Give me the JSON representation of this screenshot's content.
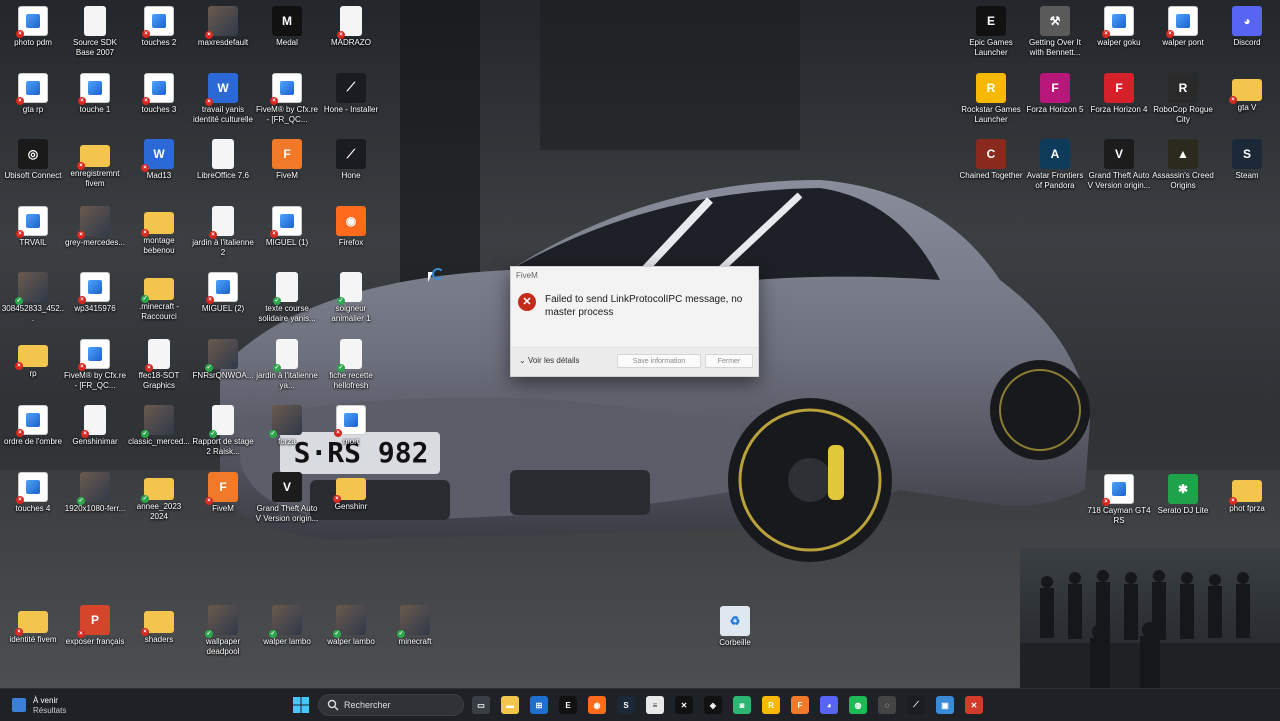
{
  "desktop": {
    "left_icons": [
      {
        "label": "photo pdm",
        "type": "img",
        "badge": "err"
      },
      {
        "label": "Source SDK Base 2007",
        "type": "doc",
        "badge": ""
      },
      {
        "label": "touches 2",
        "type": "img",
        "badge": "err"
      },
      {
        "label": "maxresdefault",
        "type": "photo",
        "badge": "err"
      },
      {
        "label": "Medal",
        "type": "app-medal",
        "badge": ""
      },
      {
        "label": "MADRAZO",
        "type": "doc",
        "badge": "err"
      },
      {
        "label": "gta rp",
        "type": "img",
        "badge": "err"
      },
      {
        "label": "touche 1",
        "type": "img",
        "badge": "err"
      },
      {
        "label": "touches 3",
        "type": "img",
        "badge": "err"
      },
      {
        "label": "travail yanis identité culturelle",
        "type": "doc-blue",
        "badge": "err"
      },
      {
        "label": "FiveM® by Cfx.re - [FR_QC...",
        "type": "img",
        "badge": "err"
      },
      {
        "label": "Hone - Installer",
        "type": "app-hone",
        "badge": ""
      },
      {
        "label": "Ubisoft Connect",
        "type": "app-ubisoft",
        "badge": ""
      },
      {
        "label": "enregistremnt fivem",
        "type": "folder",
        "badge": "err"
      },
      {
        "label": "Mad13",
        "type": "doc-blue",
        "badge": "err"
      },
      {
        "label": "LibreOffice 7.6",
        "type": "doc",
        "badge": ""
      },
      {
        "label": "FiveM",
        "type": "app-fivem",
        "badge": ""
      },
      {
        "label": "Hone",
        "type": "app-hone",
        "badge": ""
      },
      {
        "label": "TRVAIL",
        "type": "img",
        "badge": "err"
      },
      {
        "label": "grey-mercedes...",
        "type": "photo",
        "badge": "err"
      },
      {
        "label": "montage bebenou",
        "type": "folder",
        "badge": "err"
      },
      {
        "label": "jardin à l'italienne 2",
        "type": "doc",
        "badge": "err"
      },
      {
        "label": "MIGUEL (1)",
        "type": "img",
        "badge": "err"
      },
      {
        "label": "Firefox",
        "type": "app-firefox",
        "badge": ""
      },
      {
        "label": "308452833_452...",
        "type": "photo",
        "badge": "ok"
      },
      {
        "label": "wp3415976",
        "type": "img",
        "badge": "err"
      },
      {
        "label": ".minecraft - Raccourci",
        "type": "folder",
        "badge": "ok"
      },
      {
        "label": "MIGUEL (2)",
        "type": "img",
        "badge": "err"
      },
      {
        "label": "texte course solidaire yanis...",
        "type": "doc",
        "badge": "ok"
      },
      {
        "label": "soigneur animalier 1",
        "type": "doc",
        "badge": "ok"
      },
      {
        "label": "rp",
        "type": "folder",
        "badge": "err"
      },
      {
        "label": "FiveM® by Cfx.re - [FR_QC...",
        "type": "img",
        "badge": "err"
      },
      {
        "label": "ffec18-SOT Graphics",
        "type": "doc",
        "badge": "err"
      },
      {
        "label": "FNRsrQNWOA...",
        "type": "photo",
        "badge": "ok"
      },
      {
        "label": "jardin à l'italienne ya...",
        "type": "doc",
        "badge": "ok"
      },
      {
        "label": "fiche recette hellofresh",
        "type": "doc",
        "badge": "ok"
      },
      {
        "label": "ordre de l'ombre",
        "type": "img",
        "badge": "err"
      },
      {
        "label": "Genshinimar",
        "type": "doc",
        "badge": "err"
      },
      {
        "label": "classic_merced...",
        "type": "photo",
        "badge": "ok"
      },
      {
        "label": "Rapport de stage 2 Raisk...",
        "type": "doc",
        "badge": "ok"
      },
      {
        "label": "forza",
        "type": "photo",
        "badge": "ok"
      },
      {
        "label": "mort",
        "type": "img",
        "badge": "err"
      },
      {
        "label": "touches 4",
        "type": "img",
        "badge": "err"
      },
      {
        "label": "1920x1080-ferr...",
        "type": "photo",
        "badge": "ok"
      },
      {
        "label": "annee_2023 2024",
        "type": "folder",
        "badge": "ok"
      },
      {
        "label": "FiveM",
        "type": "app-fivem",
        "badge": "err"
      },
      {
        "label": "Grand Theft Auto V Version origin...",
        "type": "app-gta",
        "badge": ""
      },
      {
        "label": "Genshinr",
        "type": "folder",
        "badge": "err"
      },
      {
        "label": "identité fivem",
        "type": "folder",
        "badge": "err"
      },
      {
        "label": "exposer français",
        "type": "doc-red",
        "badge": "err"
      },
      {
        "label": "shaders",
        "type": "folder",
        "badge": "err"
      },
      {
        "label": "wallpaper deadpool",
        "type": "photo",
        "badge": "ok"
      },
      {
        "label": "walper lambo",
        "type": "photo",
        "badge": "ok"
      },
      {
        "label": "walper lambo",
        "type": "photo",
        "badge": "ok"
      },
      {
        "label": "minecraft",
        "type": "photo",
        "badge": "ok"
      }
    ],
    "right_icons": [
      {
        "label": "Epic Games Launcher",
        "type": "app-epic",
        "badge": ""
      },
      {
        "label": "Getting Over It with Bennett...",
        "type": "app-hammer",
        "badge": ""
      },
      {
        "label": "walper goku",
        "type": "img",
        "badge": "err"
      },
      {
        "label": "walper pont",
        "type": "img",
        "badge": "err"
      },
      {
        "label": "Discord",
        "type": "app-discord",
        "badge": ""
      },
      {
        "label": "Rockstar Games Launcher",
        "type": "app-rockstar",
        "badge": ""
      },
      {
        "label": "Forza Horizon 5",
        "type": "app-forza5",
        "badge": ""
      },
      {
        "label": "Forza Horizon 4",
        "type": "app-forza4",
        "badge": ""
      },
      {
        "label": "RoboCop Rogue City",
        "type": "app-robocop",
        "badge": ""
      },
      {
        "label": "gta V",
        "type": "folder",
        "badge": "err"
      },
      {
        "label": "Chained Together",
        "type": "app-chained",
        "badge": ""
      },
      {
        "label": "Avatar Frontiers of Pandora",
        "type": "app-avatar",
        "badge": ""
      },
      {
        "label": "Grand Theft Auto V Version origin...",
        "type": "app-gta",
        "badge": ""
      },
      {
        "label": "Assassin's Creed Origins",
        "type": "app-ac",
        "badge": ""
      },
      {
        "label": "Steam",
        "type": "app-steam",
        "badge": ""
      },
      {
        "label": "718 Cayman GT4 RS",
        "type": "img",
        "badge": "err"
      },
      {
        "label": "Serato DJ Lite",
        "type": "app-serato",
        "badge": ""
      },
      {
        "label": "phot fprza",
        "type": "folder",
        "badge": "err"
      },
      {
        "label": "Corbeille",
        "type": "app-bin",
        "badge": ""
      }
    ]
  },
  "car": {
    "plate": "S·RS 982"
  },
  "dialog": {
    "title": "FiveM",
    "message": "Failed to send LinkProtocolIPC message, no master process",
    "details_label": "Voir les détails",
    "save_label": "Save information",
    "close_label": "Fermer"
  },
  "taskbar": {
    "weather_line1": "À venir",
    "weather_line2": "Résultats",
    "search_placeholder": "Rechercher",
    "apps": [
      "start",
      "task-view",
      "file-explorer",
      "store",
      "epic",
      "firefox",
      "steam",
      "notepad",
      "cfx",
      "xbox",
      "hone-tb",
      "rockstar",
      "fivem-tb",
      "discord",
      "spotify",
      "chrome",
      "hone2",
      "photos",
      "fivem-err"
    ]
  },
  "colors": {
    "accent": "#0078d4",
    "error": "#c42b1c",
    "folder": "#f3c54d"
  }
}
